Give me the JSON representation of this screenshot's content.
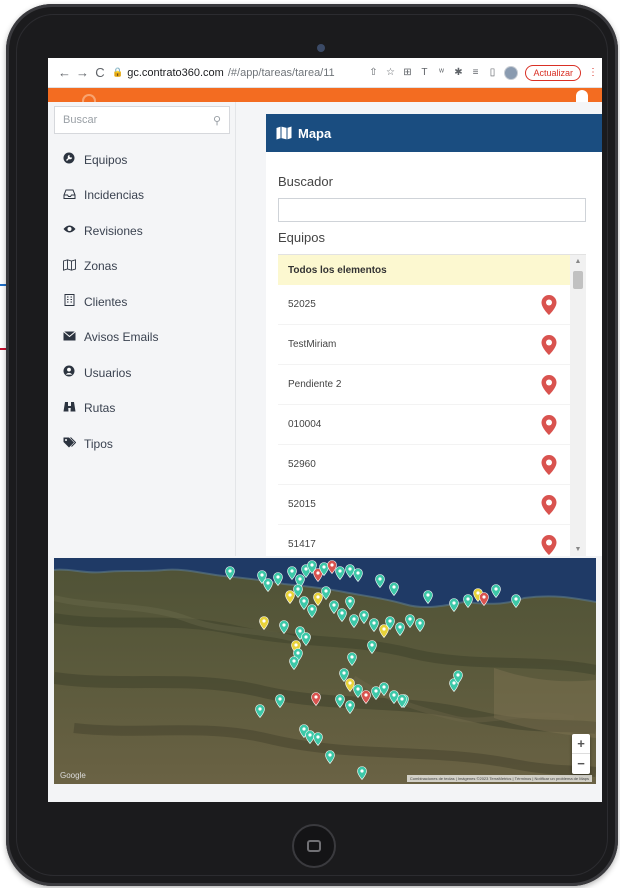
{
  "browser": {
    "url_host": "gc.contrato360.com",
    "url_path": "/#/app/tareas/tarea/11",
    "update_label": "Actualizar"
  },
  "sidebar": {
    "search_placeholder": "Buscar",
    "items": [
      {
        "label": "Equipos",
        "icon": "tools-icon"
      },
      {
        "label": "Incidencias",
        "icon": "inbox-icon"
      },
      {
        "label": "Revisiones",
        "icon": "eye-icon"
      },
      {
        "label": "Zonas",
        "icon": "map-outline-icon"
      },
      {
        "label": "Clientes",
        "icon": "building-icon"
      },
      {
        "label": "Avisos Emails",
        "icon": "envelope-icon"
      },
      {
        "label": "Usuarios",
        "icon": "user-circle-icon"
      },
      {
        "label": "Rutas",
        "icon": "binoculars-icon"
      },
      {
        "label": "Tipos",
        "icon": "tags-icon"
      }
    ]
  },
  "panel": {
    "title": "Mapa",
    "finder_label": "Buscador",
    "finder_value": "",
    "equipment_label": "Equipos",
    "list_header": "Todos los elementos",
    "items": [
      "52025",
      "TestMiriam",
      "Pendiente 2",
      "010004",
      "52960",
      "52015",
      "51417"
    ]
  },
  "map": {
    "google_label": "Google",
    "attribution": "Combinaciones de teclas | Imágenes ©2023 TerraMetrics | Términos | Notificar un problema de Maps",
    "zoom_in": "+",
    "zoom_out": "−",
    "colors": {
      "teal": "#3dc8a8",
      "yellow": "#e8d23a",
      "red": "#d9534f",
      "sea": "#1f3a66",
      "land": "#5a5a3e"
    }
  },
  "colors": {
    "brand_orange": "#f36c21",
    "header_blue": "#1a4d80",
    "pin_red": "#d9534f",
    "list_header_bg": "#fcf8d0"
  }
}
